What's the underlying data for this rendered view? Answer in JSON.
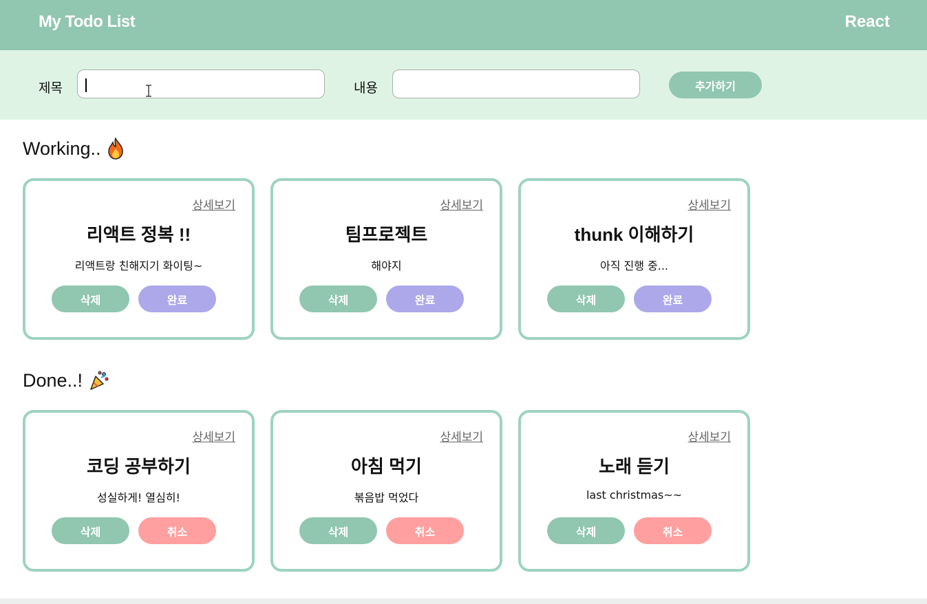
{
  "header": {
    "title": "My Todo List",
    "right_label": "React"
  },
  "form": {
    "title_label": "제목",
    "title_value": "",
    "content_label": "내용",
    "content_value": "",
    "add_button": "추가하기"
  },
  "sections": {
    "working": {
      "title": "Working..",
      "icon": "fire-icon"
    },
    "done": {
      "title": "Done..!",
      "icon": "party-popper-icon"
    }
  },
  "working_cards": [
    {
      "detail": "상세보기",
      "title": "리액트 정복 !!",
      "body": "리액트랑 친해지기 화이팅~",
      "delete": "삭제",
      "toggle": "완료"
    },
    {
      "detail": "상세보기",
      "title": "팀프로젝트",
      "body": "해야지",
      "delete": "삭제",
      "toggle": "완료"
    },
    {
      "detail": "상세보기",
      "title": "thunk 이해하기",
      "body": "아직 진행 중...",
      "delete": "삭제",
      "toggle": "완료"
    }
  ],
  "done_cards": [
    {
      "detail": "상세보기",
      "title": "코딩 공부하기",
      "body": "성실하게! 열심히!",
      "delete": "삭제",
      "toggle": "취소"
    },
    {
      "detail": "상세보기",
      "title": "아침 먹기",
      "body": "볶음밥 먹었다",
      "delete": "삭제",
      "toggle": "취소"
    },
    {
      "detail": "상세보기",
      "title": "노래 듣기",
      "body": "last christmas~~",
      "delete": "삭제",
      "toggle": "취소"
    }
  ],
  "colors": {
    "header_bg": "#91c6b0",
    "form_bg": "#dff3e4",
    "card_border": "#9ed3c1",
    "delete_button": "#91c6b0",
    "complete_button": "#aca8ea",
    "cancel_button": "#ff9f9f"
  }
}
